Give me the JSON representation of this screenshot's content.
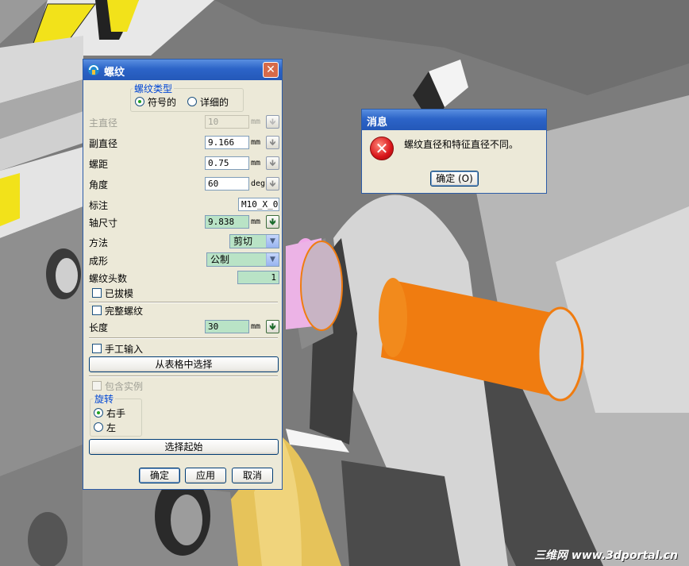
{
  "thread_dialog": {
    "title": "螺纹",
    "close_glyph": "✕",
    "thread_type_group": "螺纹类型",
    "thread_type_options": [
      {
        "label": "符号的",
        "selected": true
      },
      {
        "label": "详细的",
        "selected": false
      }
    ],
    "fields": [
      {
        "label": "主直径",
        "value": "10",
        "unit": "mm",
        "enabled": false
      },
      {
        "label": "副直径",
        "value": "9.166",
        "unit": "mm",
        "enabled": true
      },
      {
        "label": "螺距",
        "value": "0.75",
        "unit": "mm",
        "enabled": true
      },
      {
        "label": "角度",
        "value": "60",
        "unit": "deg",
        "enabled": true
      }
    ],
    "callout_label": "标注",
    "callout_value": "M10_X_0.",
    "shaft_size_label": "轴尺寸",
    "shaft_size_value": "9.838",
    "shaft_size_unit": "mm",
    "method_label": "方法",
    "method_value": "剪切",
    "form_label": "成形",
    "form_value": "公制",
    "starts_label": "螺纹头数",
    "starts_value": "1",
    "tapered_label": "已拔模",
    "tapered_checked": false,
    "full_thread_label": "完整螺纹",
    "full_thread_checked": false,
    "length_label": "长度",
    "length_value": "30",
    "length_unit": "mm",
    "manual_input_label": "手工输入",
    "manual_input_checked": false,
    "choose_from_table_label": "从表格中选择",
    "include_instances_label": "包含实例",
    "include_instances_checked": false,
    "rotation_group": "旋转",
    "rotation_options": [
      {
        "label": "右手",
        "selected": true
      },
      {
        "label": "左",
        "selected": false
      }
    ],
    "select_start_label": "选择起始",
    "ok_label": "确定",
    "apply_label": "应用",
    "cancel_label": "取消"
  },
  "message_box": {
    "title": "消息",
    "message": "螺纹直径和特征直径不同。",
    "ok_label": "确定 (O)"
  },
  "watermark": "三维网 www.3dportal.cn",
  "colors": {
    "title_bar": "#2c64c8",
    "dialog_bg": "#ece9d8",
    "field_active": "#b9e3c6",
    "orange_part": "#f07c10",
    "background": "#7a7a7a"
  }
}
